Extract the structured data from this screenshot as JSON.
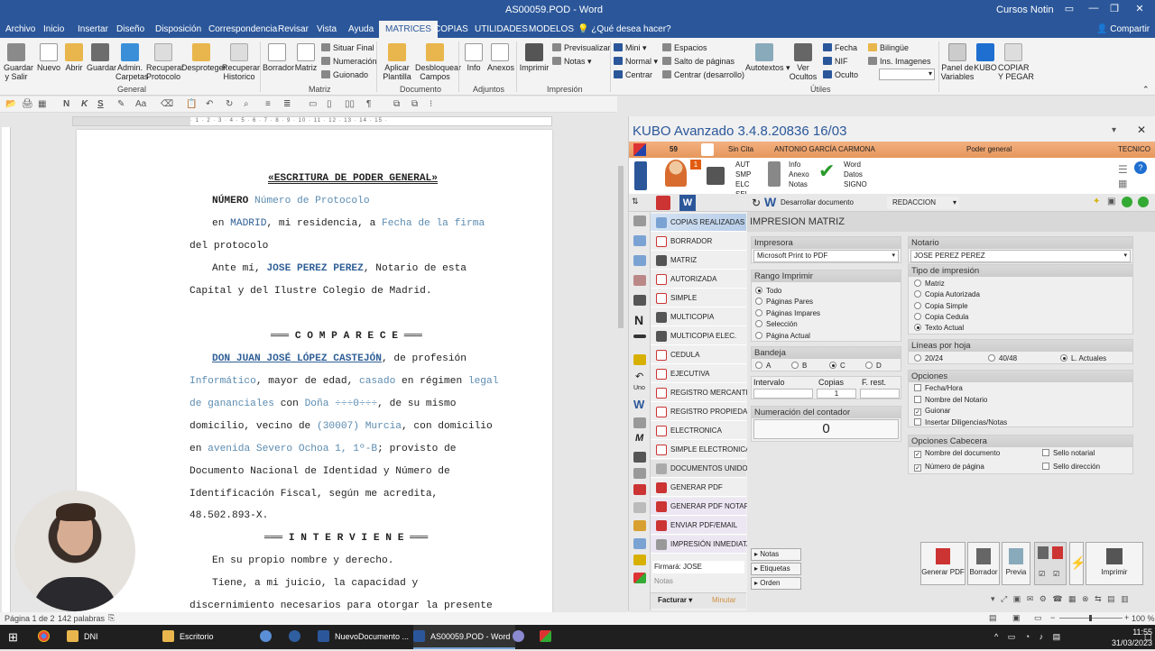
{
  "titlebar": {
    "title": "AS00059.POD  -  Word",
    "user": "Cursos Notin"
  },
  "menu": [
    "Archivo",
    "Inicio",
    "Insertar",
    "Diseño",
    "Disposición",
    "Correspondencia",
    "Revisar",
    "Vista",
    "Ayuda",
    "MATRICES",
    "COPIAS",
    "UTILIDADES",
    "MODELOS"
  ],
  "menu_tell": "¿Qué desea hacer?",
  "menu_share": "Compartir",
  "ribbon": {
    "guardar_salir": "Guardar\ny Salir",
    "nuevo": "Nuevo",
    "abrir": "Abrir",
    "guardar": "Guardar",
    "admin": "Admin.\nCarpetas",
    "recuperar_protocolo": "Recuperar\nProtocolo",
    "desproteger": "Desproteger",
    "recuperar_historico": "Recuperar\nHistorico",
    "borrador": "Borrador",
    "matriz": "Matriz",
    "situar_final": "Situar Final",
    "numeracion": "Numeración",
    "guionado": "Guionado",
    "aplicar": "Aplicar\nPlantilla",
    "desbloquear": "Desbloquear\nCampos",
    "info": "Info",
    "anexos": "Anexos",
    "imprimir": "Imprimir",
    "previsualizar": "Previsualizar",
    "notas": "Notas",
    "mini": "Mini",
    "normal": "Normal",
    "centrar": "Centrar",
    "espacios": "Espacios",
    "salto": "Salto de páginas",
    "centrar_des": "Centrar (desarrollo)",
    "autotextos": "Autotextos",
    "ver_ocultos": "Ver\nOcultos",
    "fecha": "Fecha",
    "nif": "NIF",
    "oculto": "Oculto",
    "bilingue": "Bilingüe",
    "ins_imagenes": "Ins. Imagenes",
    "panel": "Panel de\nVariables",
    "kubo": "KUBO",
    "copiar": "COPIAR\nY PEGAR",
    "groups": {
      "general": "General",
      "matriz": "Matriz",
      "documento": "Documento",
      "adjuntos": "Adjuntos",
      "impresion": "Impresión",
      "utiles": "Útiles"
    }
  },
  "document": {
    "title": "«ESCRITURA DE PODER GENERAL»",
    "numero_label": "NÚMERO",
    "numero_field": "Número de Protocolo",
    "en": "en",
    "madrid": "MADRID",
    "residencia": ", mi residencia, a",
    "fecha_field": "Fecha de la firma",
    "del_protocolo": "del protocolo",
    "ante_mi": "Ante mí,",
    "notario": "JOSE PEREZ PEREZ",
    "notario_de": ", Notario de esta",
    "capital": "Capital y del Ilustre Colegio de Madrid.",
    "comparece": "═══ C O M P A R E C E ═══",
    "compareciente": "DON JUAN JOSÉ LÓPEZ CASTEJÓN",
    "de_profesion": ", de profesión",
    "informatico": "Informático",
    "mayor": ", mayor de edad,",
    "casado": "casado",
    "en_regimen": "en régimen",
    "legal": "legal",
    "gananciales": "de gananciales",
    "con": "con",
    "dona": "Doña ÷÷÷0÷÷÷",
    "de_su": ", de su mismo",
    "domicilio": "domicilio, vecino de",
    "murcia": "(30007) Murcia",
    ", con domicilio": ", con domicilio",
    "avenida": "avenida Severo Ochoa 1, 1º-B",
    ", provisto de": "; provisto de",
    "documento": "Documento Nacional de Identidad y Número de",
    "identificacion": "Identificación Fiscal, según me acredita,",
    "dni": "48.502.893-X.",
    "interviene": "═══ I N T E R V I E N E ═══",
    "propio": "En su propio nombre y derecho.",
    "tiene": "Tiene, a mi juicio, la capacidad y",
    "discernimiento": "discernimiento necesarios para otorgar la presente"
  },
  "status": {
    "page": "Página 1 de 2",
    "words": "142 palabras",
    "zoom": "100 %"
  },
  "kubo": {
    "title": "KUBO Avanzado 3.4.8.20836   16/03",
    "bar": {
      "num": "59",
      "sin_cita": "Sin Cita",
      "cliente": "ANTONIO GARCÍA CARMONA",
      "acto": "Poder general",
      "rol": "TECNICO"
    },
    "top": {
      "badge": "1",
      "aut": "AUT\nSMP\nELC\nSEL",
      "ard": "Info\nAnexo\nNotas",
      "word": "Word\nDatos\nSIGNO"
    },
    "tools": {
      "desarrollar": "Desarrollar documento",
      "redaccion": "REDACCION"
    },
    "list": [
      "COPIAS REALIZADAS",
      "BORRADOR",
      "MATRIZ",
      "AUTORIZADA",
      "SIMPLE",
      "MULTICOPIA",
      "MULTICOPIA ELEC.",
      "CEDULA",
      "EJECUTIVA",
      "REGISTRO MERCANTIL",
      "REGISTRO PROPIEDAD",
      "ELECTRONICA",
      "SIMPLE ELECTRONICA",
      "DOCUMENTOS UNIDOS",
      "GENERAR PDF",
      "GENERAR PDF NOTARIAL",
      "ENVIAR PDF/EMAIL",
      "IMPRESIÓN INMEDIATA"
    ],
    "firmara": "Firmará: JOSE",
    "notas": "Notas",
    "facturar": "Facturar",
    "minutar": "Minutar",
    "panel": {
      "header": "IMPRESION MATRIZ",
      "impresora_label": "Impresora",
      "impresora": "Microsoft Print to PDF",
      "rango_label": "Rango Imprimir",
      "rango": [
        "Todo",
        "Páginas Pares",
        "Páginas Impares",
        "Selección",
        "Página Actual"
      ],
      "bandeja_label": "Bandeja",
      "bandeja": [
        "A",
        "B",
        "C",
        "D"
      ],
      "intervalo": "Intervalo",
      "copias": "Copias",
      "copias_val": "1",
      "frest": "F. rest.",
      "numeracion_label": "Numeración del contador",
      "numeracion_val": "0",
      "notario_label": "Notario",
      "notario": "JOSE PEREZ PEREZ",
      "tipo_label": "Tipo de impresión",
      "tipo": [
        "Matriz",
        "Copia Autorizada",
        "Copia Simple",
        "Copia Cedula",
        "Texto Actual"
      ],
      "lineas_label": "Líneas por hoja",
      "lineas": [
        "20/24",
        "40/48",
        "L. Actuales"
      ],
      "opciones_label": "Opciones",
      "opciones": [
        "Fecha/Hora",
        "Nombre del Notario",
        "Guionar",
        "Insertar Diligencias/Notas"
      ],
      "cabecera_label": "Opciones Cabecera",
      "cabecera": [
        "Nombre del documento",
        "Sello notarial",
        "Número de página",
        "Sello dirección"
      ],
      "btn_notas": "Notas",
      "btn_etiquetas": "Etiquetas",
      "btn_orden": "Orden",
      "btn_pdf": "Generar PDF",
      "btn_borrador": "Borrador",
      "btn_previa": "Previa",
      "btn_imprimir": "Imprimir"
    }
  },
  "taskbar": {
    "dni": "DNI",
    "escritorio": "Escritorio",
    "nuevo": "NuevoDocumento ...",
    "word": "AS00059.POD - Word",
    "time": "11:55",
    "date": "31/03/2023"
  }
}
